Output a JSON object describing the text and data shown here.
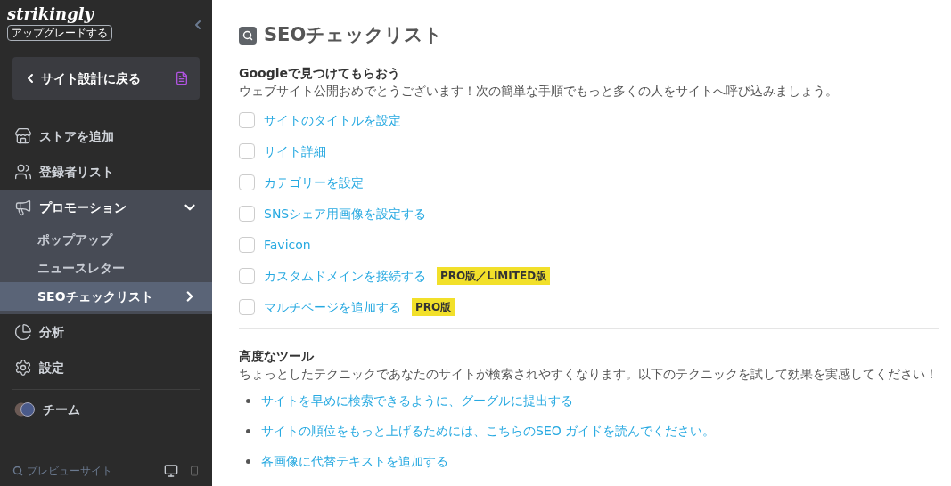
{
  "sidebar": {
    "logo": "strikingly",
    "upgrade": "アップグレードする",
    "back_button": "サイト設計に戻る",
    "items": [
      {
        "kind": "store",
        "label": "ストアを追加",
        "selected": false
      },
      {
        "kind": "people",
        "label": "登録者リスト",
        "selected": false
      },
      {
        "kind": "megaphone",
        "label": "プロモーション",
        "selected": false,
        "expanded": true,
        "children": [
          {
            "label": "ポップアップ",
            "selected": false
          },
          {
            "label": "ニュースレター",
            "selected": false
          },
          {
            "label": "SEOチェックリスト",
            "selected": true
          }
        ]
      },
      {
        "kind": "pie",
        "label": "分析",
        "selected": false
      },
      {
        "kind": "gear",
        "label": "設定",
        "selected": false
      }
    ],
    "team": "チーム",
    "preview": "プレビューサイト"
  },
  "main": {
    "title": "SEOチェックリスト",
    "section1": {
      "heading": "Googleで見つけてもらおう",
      "description": "ウェブサイト公開おめでとうございます！次の簡単な手順でもっと多くの人をサイトへ呼び込みましょう。",
      "checklist": [
        {
          "label": "サイトのタイトルを設定",
          "checked": false
        },
        {
          "label": "サイト詳細",
          "checked": false
        },
        {
          "label": "カテゴリーを設定",
          "checked": false
        },
        {
          "label": "SNSシェア用画像を設定する",
          "checked": false
        },
        {
          "label": "Favicon",
          "checked": false
        },
        {
          "label": "カスタムドメインを接続する",
          "checked": false,
          "badge": "PRO版／LIMITED版"
        },
        {
          "label": "マルチページを追加する",
          "checked": false,
          "badge": "PRO版"
        }
      ]
    },
    "section2": {
      "heading": "高度なツール",
      "description": "ちょっとしたテクニックであなたのサイトが検索されやすくなります。以下のテクニックを試して効果を実感してください！",
      "links": [
        "サイトを早めに検索できるように、グーグルに提出する",
        "サイトの順位をもっと上げるためには、こちらのSEO ガイドを読んでください。",
        "各画像に代替テキストを追加する"
      ]
    }
  }
}
